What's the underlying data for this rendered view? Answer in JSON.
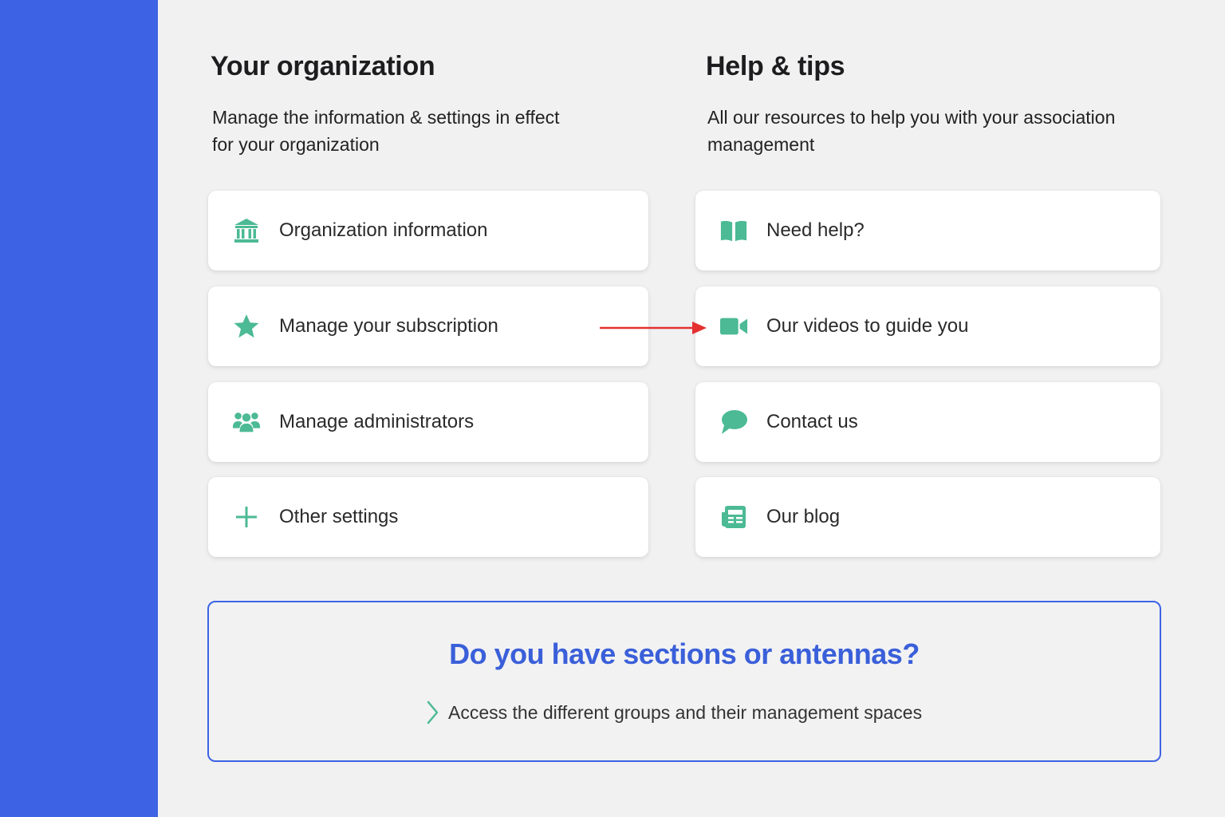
{
  "colors": {
    "sidebar": "#3d63e4",
    "icon_green": "#4cba94",
    "accent_blue": "#3a5fd9",
    "arrow_red": "#e53030"
  },
  "organization": {
    "title": "Your organization",
    "description_line1": "Manage the information & settings in effect",
    "description_line2": "for your organization",
    "items": [
      {
        "label": "Organization information",
        "icon": "bank-building-icon"
      },
      {
        "label": "Manage your subscription",
        "icon": "star-icon"
      },
      {
        "label": "Manage administrators",
        "icon": "users-group-icon"
      },
      {
        "label": "Other settings",
        "icon": "plus-icon"
      }
    ]
  },
  "help": {
    "title": "Help & tips",
    "description_line1": "All our resources to help you with your association",
    "description_line2": "management",
    "items": [
      {
        "label": "Need help?",
        "icon": "open-book-icon"
      },
      {
        "label": "Our videos to guide you",
        "icon": "video-camera-icon"
      },
      {
        "label": "Contact us",
        "icon": "chat-bubble-icon"
      },
      {
        "label": "Our blog",
        "icon": "newspaper-icon"
      }
    ]
  },
  "sections": {
    "title": "Do you have sections or antennas?",
    "link_text": "Access the different groups and their management spaces",
    "link_icon": "chevron-right-icon"
  }
}
